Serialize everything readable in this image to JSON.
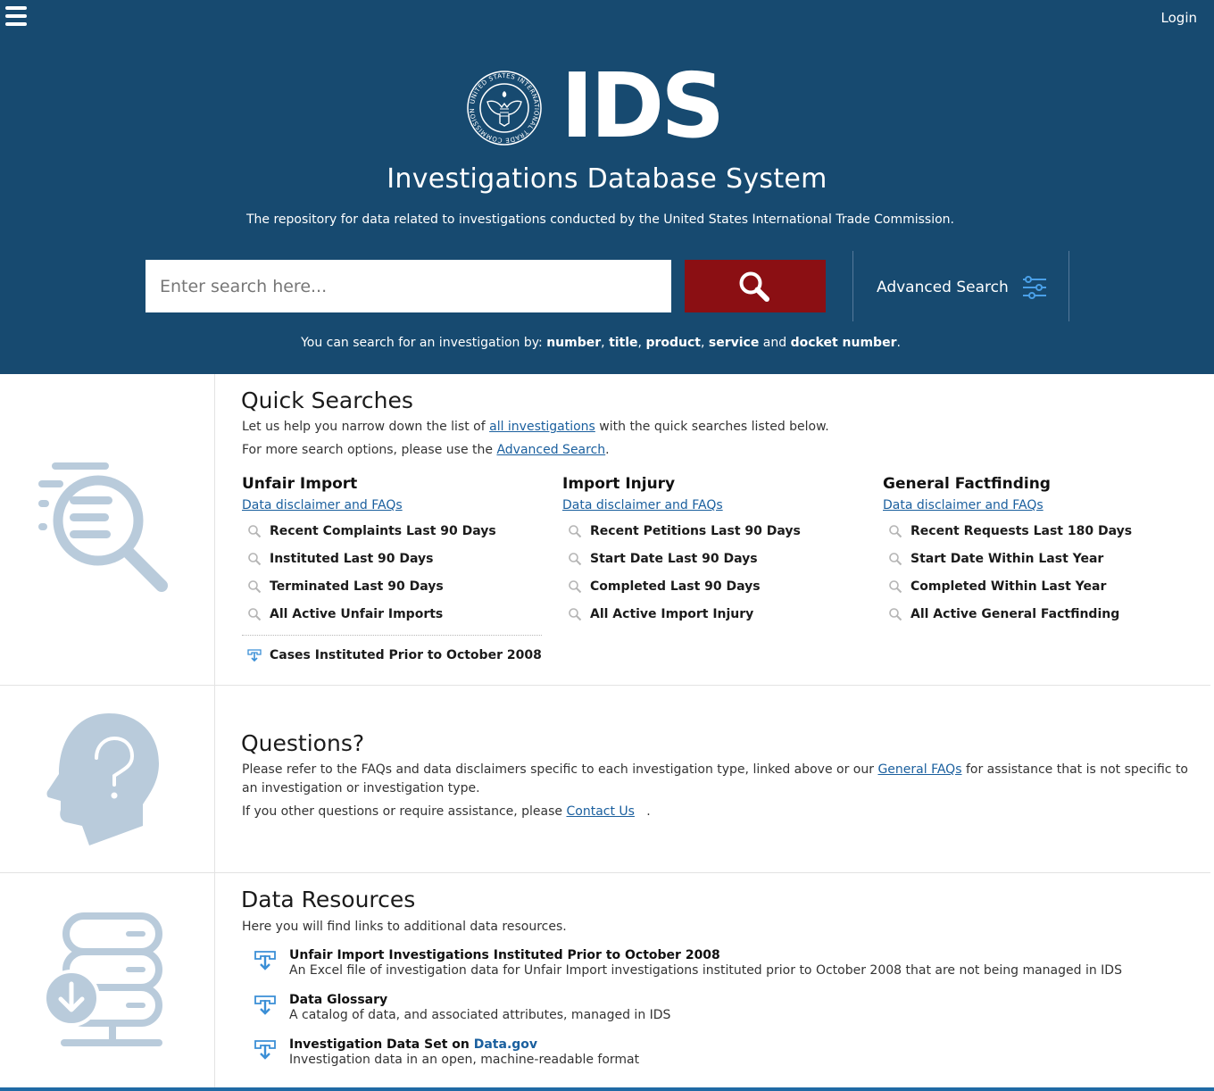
{
  "header": {
    "login_label": "Login",
    "logo_text": "IDS",
    "seal_text": "UNITED STATES INTERNATIONAL TRADE COMMISSION",
    "title": "Investigations Database System",
    "tagline": "The repository for data related to investigations conducted by the United States International Trade Commission.",
    "search_placeholder": "Enter search here...",
    "advanced_search_label": "Advanced Search",
    "hint_prefix": "You can search for an investigation by: ",
    "hint_terms": [
      "number",
      "title",
      "product",
      "service",
      "docket number"
    ],
    "hint_sep1": ", ",
    "hint_and": " and ",
    "hint_end": "."
  },
  "quick": {
    "title": "Quick Searches",
    "line1_pre": "Let us help you narrow down the list of ",
    "line1_link": "all investigations",
    "line1_post": " with the quick searches listed below.",
    "line2_pre": "For more search options, please use the ",
    "line2_link": "Advanced Search",
    "line2_post": ".",
    "columns": [
      {
        "heading": "Unfair Import",
        "link": "Data disclaimer and FAQs ",
        "items": [
          "Recent Complaints Last 90 Days",
          "Instituted Last 90 Days",
          "Terminated Last 90 Days",
          "All Active Unfair Imports"
        ]
      },
      {
        "heading": "Import Injury",
        "link": "Data disclaimer and FAQs ",
        "items": [
          "Recent Petitions Last 90 Days",
          "Start Date Last 90 Days",
          "Completed Last 90 Days",
          "All Active Import Injury"
        ]
      },
      {
        "heading": "General Factfinding",
        "link": "Data disclaimer and FAQs ",
        "items": [
          "Recent Requests Last 180 Days",
          "Start Date Within Last Year",
          "Completed Within Last Year",
          "All Active General Factfinding"
        ]
      }
    ],
    "download_item": "Cases Instituted Prior to October 2008"
  },
  "questions": {
    "title": "Questions?",
    "p1_pre": "Please refer to the FAQs and data disclaimers specific to each investigation type, linked above or our ",
    "p1_link": "General FAQs",
    "p1_post": " for assistance that is not specific to",
    "p1_line2": "an investigation or investigation type.",
    "p2_pre": "If you other questions or require assistance, please ",
    "p2_link": "Contact Us",
    "p2_post": "   ."
  },
  "resources": {
    "title": "Data Resources",
    "intro": "Here you will find links to additional data resources.",
    "items": [
      {
        "title": "Unfair Import Investigations Instituted Prior to October 2008",
        "desc": "An Excel file of investigation data for Unfair Import investigations instituted prior to October 2008 that are not being managed in IDS"
      },
      {
        "title": "Data Glossary",
        "desc": "A catalog of data, and associated attributes, managed in IDS"
      },
      {
        "title": "Investigation Data Set on ",
        "title_link": "Data.gov",
        "desc": "Investigation data in an open, machine-readable format"
      }
    ]
  },
  "colors": {
    "header_bg": "#174a70",
    "search_button": "#8b0f13",
    "link": "#1a5f9e",
    "illustration": "#b9cbdb"
  }
}
